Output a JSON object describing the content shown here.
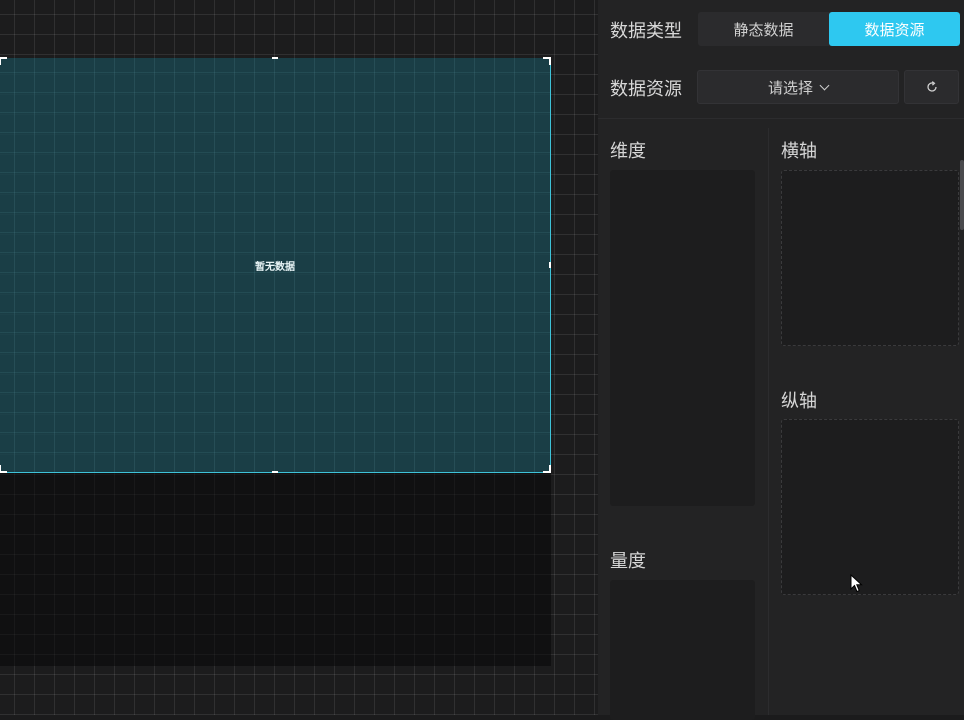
{
  "canvas": {
    "empty_text": "暂无数据"
  },
  "panel": {
    "data_type_label": "数据类型",
    "data_type_options": [
      "静态数据",
      "数据资源"
    ],
    "data_type_selected": "数据资源",
    "data_source_label": "数据资源",
    "data_source_placeholder": "请选择",
    "dimension_label": "维度",
    "measure_label": "量度",
    "x_axis_label": "横轴",
    "y_axis_label": "纵轴"
  },
  "colors": {
    "accent": "#2ec8f0",
    "selection_border": "#3ec2d8"
  },
  "icons": {
    "refresh": "refresh-icon",
    "chevron": "chevron-down-icon"
  }
}
